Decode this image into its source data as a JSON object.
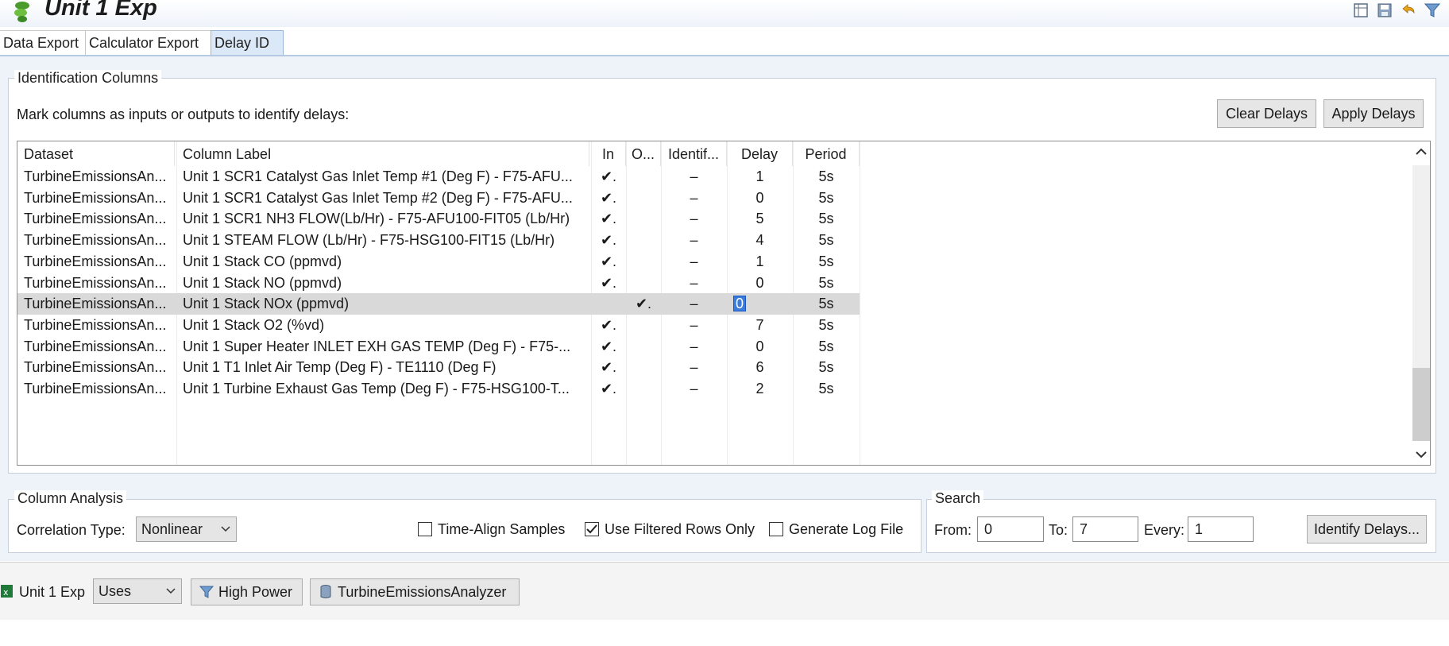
{
  "title": "Unit 1 Exp",
  "tabs": [
    {
      "label": "Data Export"
    },
    {
      "label": "Calculator Export"
    },
    {
      "label": "Delay ID"
    }
  ],
  "identification": {
    "legend": "Identification Columns",
    "instruction": "Mark columns as inputs or outputs to identify delays:",
    "clear_button": "Clear Delays",
    "apply_button": "Apply Delays"
  },
  "table": {
    "headers": {
      "dataset": "Dataset",
      "column_label": "Column Label",
      "in": "In",
      "out": "O...",
      "identified": "Identif...",
      "delay": "Delay",
      "period": "Period"
    },
    "rows": [
      {
        "dataset": "TurbineEmissionsAn...",
        "label": "Unit 1 SCR1 Catalyst Gas Inlet Temp #1 (Deg F) - F75-AFU...",
        "in": "✔.",
        "out": "",
        "identified": "–",
        "delay": "1",
        "period": "5s"
      },
      {
        "dataset": "TurbineEmissionsAn...",
        "label": "Unit 1 SCR1 Catalyst Gas Inlet Temp #2 (Deg F) - F75-AFU...",
        "in": "✔.",
        "out": "",
        "identified": "–",
        "delay": "0",
        "period": "5s"
      },
      {
        "dataset": "TurbineEmissionsAn...",
        "label": "Unit 1 SCR1 NH3 FLOW(Lb/Hr) - F75-AFU100-FIT05 (Lb/Hr)",
        "in": "✔.",
        "out": "",
        "identified": "–",
        "delay": "5",
        "period": "5s"
      },
      {
        "dataset": "TurbineEmissionsAn...",
        "label": "Unit 1 STEAM FLOW (Lb/Hr) - F75-HSG100-FIT15 (Lb/Hr)",
        "in": "✔.",
        "out": "",
        "identified": "–",
        "delay": "4",
        "period": "5s"
      },
      {
        "dataset": "TurbineEmissionsAn...",
        "label": "Unit 1 Stack CO (ppmvd)",
        "in": "✔.",
        "out": "",
        "identified": "–",
        "delay": "1",
        "period": "5s"
      },
      {
        "dataset": "TurbineEmissionsAn...",
        "label": "Unit 1 Stack NO (ppmvd)",
        "in": "✔.",
        "out": "",
        "identified": "–",
        "delay": "0",
        "period": "5s"
      },
      {
        "dataset": "TurbineEmissionsAn...",
        "label": "Unit 1 Stack NOx (ppmvd)",
        "in": "",
        "out": "✔.",
        "identified": "–",
        "delay": "0",
        "period": "5s",
        "selected": true
      },
      {
        "dataset": "TurbineEmissionsAn...",
        "label": "Unit 1 Stack O2 (%vd)",
        "in": "✔.",
        "out": "",
        "identified": "–",
        "delay": "7",
        "period": "5s"
      },
      {
        "dataset": "TurbineEmissionsAn...",
        "label": "Unit 1 Super Heater INLET EXH GAS TEMP (Deg F) - F75-...",
        "in": "✔.",
        "out": "",
        "identified": "–",
        "delay": "0",
        "period": "5s"
      },
      {
        "dataset": "TurbineEmissionsAn...",
        "label": "Unit 1 T1 Inlet Air Temp (Deg F) - TE1110 (Deg F)",
        "in": "✔.",
        "out": "",
        "identified": "–",
        "delay": "6",
        "period": "5s"
      },
      {
        "dataset": "TurbineEmissionsAn...",
        "label": "Unit 1 Turbine Exhaust Gas Temp (Deg F) - F75-HSG100-T...",
        "in": "✔.",
        "out": "",
        "identified": "–",
        "delay": "2",
        "period": "5s"
      }
    ]
  },
  "column_analysis": {
    "legend": "Column Analysis",
    "correlation_label": "Correlation Type:",
    "correlation_value": "Nonlinear",
    "time_align_label": "Time-Align Samples",
    "time_align_checked": false,
    "filtered_label": "Use Filtered Rows Only",
    "filtered_checked": true,
    "log_label": "Generate Log File",
    "log_checked": false
  },
  "search": {
    "legend": "Search",
    "from_label": "From:",
    "from_value": "0",
    "to_label": "To:",
    "to_value": "7",
    "every_label": "Every:",
    "every_value": "1",
    "identify_button": "Identify Delays..."
  },
  "statusbar": {
    "workbook": "Unit 1 Exp",
    "uses_value": "Uses",
    "filter": "High Power",
    "dataset": "TurbineEmissionsAnalyzer"
  },
  "icons": [
    "app-logo-icon",
    "columns-icon",
    "save-icon",
    "undo-icon",
    "filter-icon",
    "chevron-up-icon",
    "chevron-down-icon",
    "dropdown-arrow-icon",
    "excel-icon",
    "funnel-icon",
    "database-icon"
  ]
}
